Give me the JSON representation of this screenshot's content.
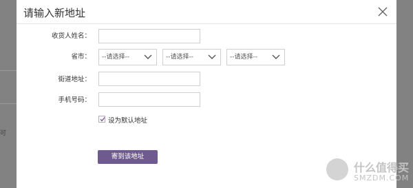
{
  "modal": {
    "title": "请输入新地址",
    "close_icon": "close-icon"
  },
  "form": {
    "recipient_name": {
      "label": "收货人姓名：",
      "value": ""
    },
    "province_city": {
      "label": "省市：",
      "selects": [
        {
          "selected": "--请选择--"
        },
        {
          "selected": "--请选择--"
        },
        {
          "selected": "--请选择--"
        }
      ]
    },
    "street_address": {
      "label": "街道地址：",
      "value": ""
    },
    "phone": {
      "label": "手机号码：",
      "value": ""
    },
    "default_checkbox": {
      "label": "设为默认地址",
      "checked": true
    },
    "submit_label": "寄到该地址"
  },
  "background": {
    "partial_text": "可"
  },
  "watermark": {
    "logo_text": "什么值得买",
    "url_text": "SMZDM.COM"
  },
  "colors": {
    "accent": "#6e5a8f",
    "border": "#cfcfcf",
    "overlay": "#7a7a7a"
  }
}
